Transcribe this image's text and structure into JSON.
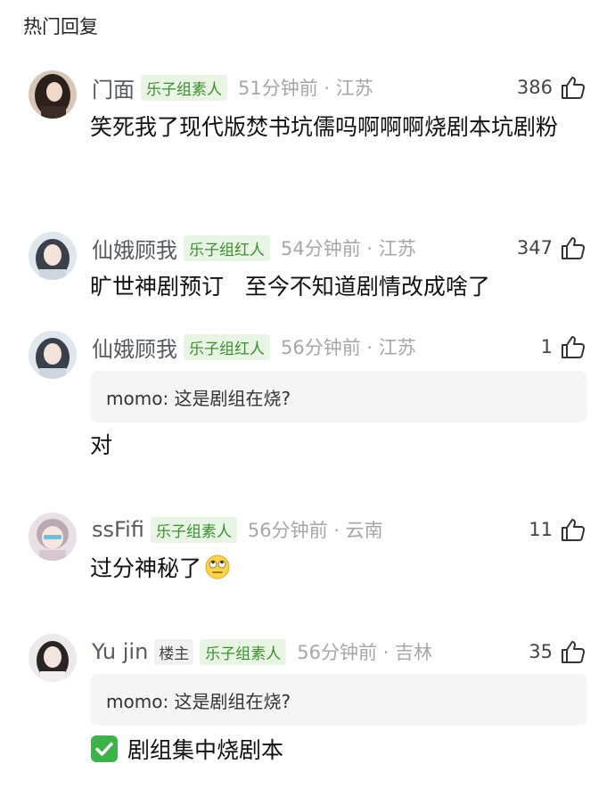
{
  "section": {
    "title": "热门回复"
  },
  "comments": [
    {
      "username": "门面",
      "tag": "乐子组素人",
      "meta": "51分钟前 · 江苏",
      "likes": "386",
      "text": "笑死我了现代版焚书坑儒吗啊啊啊烧剧本坑剧粉"
    },
    {
      "username": "仙娥顾我",
      "tag": "乐子组红人",
      "meta": "54分钟前 · 江苏",
      "likes": "347",
      "text": "旷世神剧预订   至今不知道剧情改成啥了"
    },
    {
      "username": "仙娥顾我",
      "tag": "乐子组红人",
      "meta": "56分钟前 · 江苏",
      "likes": "1",
      "quote": "momo: 这是剧组在烧?",
      "text": "对"
    },
    {
      "username": "ssFifi",
      "tag": "乐子组素人",
      "meta": "56分钟前 · 云南",
      "likes": "11",
      "text": "过分神秘了",
      "emoji": "eye-roll-emoji"
    },
    {
      "username": "Yu jin",
      "owner_tag": "楼主",
      "tag": "乐子组素人",
      "meta": "56分钟前 · 吉林",
      "likes": "35",
      "quote": "momo: 这是剧组在烧?",
      "text": "剧组集中烧剧本",
      "icon": "check-mark-icon"
    }
  ],
  "colors": {
    "fan_tag_text": "#3a8f2e",
    "fan_tag_bg": "#e8f5e4",
    "meta_text": "#a7a7a7",
    "check_green": "#3db14a"
  }
}
